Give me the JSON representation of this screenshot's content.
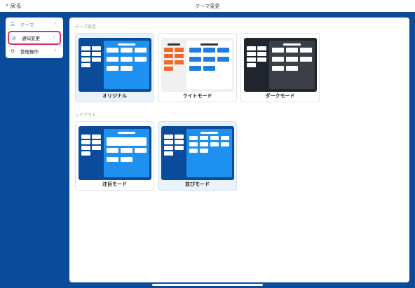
{
  "header": {
    "back_label": "戻る",
    "back_icon": "chevron-left-icon",
    "title": "テーマ変更"
  },
  "sidebar": {
    "items": [
      {
        "label": "テーマ",
        "icon": "theme-grid-icon",
        "state": "active"
      },
      {
        "label": "通知変更",
        "icon": "notification-icon",
        "state": "selected"
      },
      {
        "label": "管理操作",
        "icon": "gear-icon",
        "state": "normal"
      }
    ]
  },
  "sections": {
    "theme_label": "テーマ設定",
    "layout_label": "レイアウト"
  },
  "themes": [
    {
      "label": "オリジナル",
      "selected": true
    },
    {
      "label": "ライトモード",
      "selected": false
    },
    {
      "label": "ダークモード",
      "selected": false
    }
  ],
  "layouts": [
    {
      "label": "注目モード",
      "selected": false
    },
    {
      "label": "並びモード",
      "selected": true
    }
  ],
  "colors": {
    "brand_blue": "#0a4c9a",
    "accent_blue": "#1e90f0",
    "highlight_pink": "#d3356e",
    "active_text": "#2b80d6",
    "light_orange": "#f06a2a",
    "dark_bg": "#20252e"
  }
}
